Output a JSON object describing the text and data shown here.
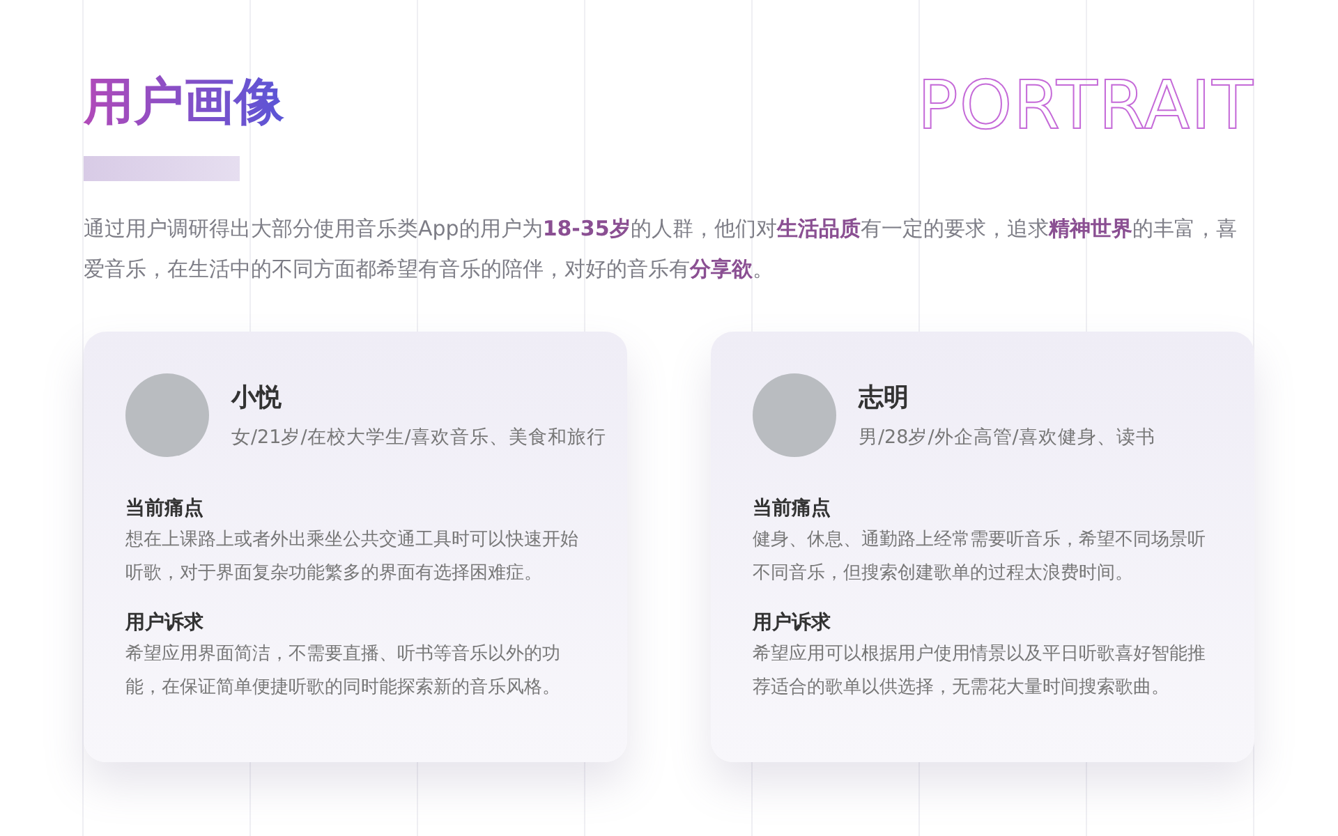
{
  "title": "用户画像",
  "heading_en": "PORTRAIT",
  "intro": "通过用户调研得出大部分使用音乐类App的用户为**18-35岁**的人群，他们对**生活品质**有一定的要求，追求**精神世界**的丰富，喜爱音乐，在生活中的不同方面都希望有音乐的陪伴，对好的音乐有**分享欲**。",
  "profiles": [
    {
      "name": "小悦",
      "description": "女/21岁/在校大学生/喜欢音乐、美食和旅行",
      "sections": [
        {
          "heading": "当前痛点",
          "body": "想在上课路上或者外出乘坐公共交通工具时可以快速开始听歌，对于界面复杂功能繁多的界面有选择困难症。"
        },
        {
          "heading": "用户诉求",
          "body": "希望应用界面简洁，不需要直播、听书等音乐以外的功能，在保证简单便捷听歌的同时能探索新的音乐风格。"
        }
      ]
    },
    {
      "name": "志明",
      "description": "男/28岁/外企高管/喜欢健身、读书",
      "sections": [
        {
          "heading": "当前痛点",
          "body": "健身、休息、通勤路上经常需要听音乐，希望不同场景听不同音乐，但搜索创建歌单的过程太浪费时间。"
        },
        {
          "heading": "用户诉求",
          "body": "希望应用可以根据用户使用情景以及平日听歌喜好智能推荐适合的歌单以供选择，无需花大量时间搜索歌曲。"
        }
      ]
    }
  ]
}
